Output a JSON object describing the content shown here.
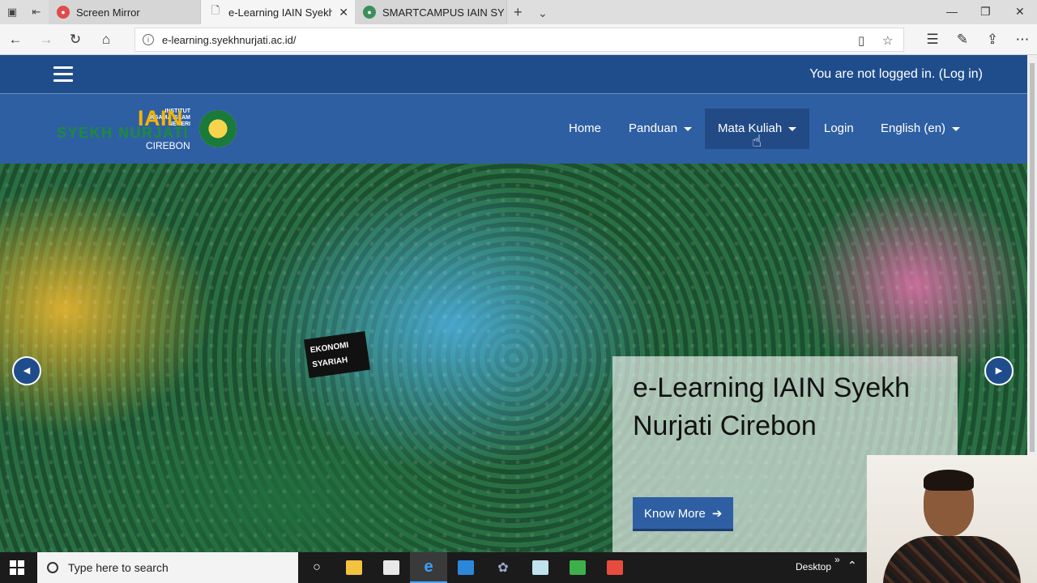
{
  "browser": {
    "tabs": [
      {
        "label": "Screen Mirror",
        "state": "inactive"
      },
      {
        "label": "e-Learning IAIN Syekh N",
        "state": "active"
      },
      {
        "label": "SMARTCAMPUS IAIN SYEKH",
        "state": "inactive"
      }
    ],
    "url": "e-learning.syekhnurjati.ac.id/"
  },
  "site": {
    "login_text": "You are not logged in.",
    "login_link": "(Log in)",
    "logo": {
      "small_line1": "INSTITUT",
      "small_line2": "AGAMA ISLAM",
      "small_line3": "NEGERI",
      "iain": "IAIN",
      "syekh": "SYEKH NURJATI",
      "city": "CIREBON"
    },
    "menu": [
      {
        "label": "Home",
        "has_caret": false
      },
      {
        "label": "Panduan",
        "has_caret": true
      },
      {
        "label": "Mata Kuliah",
        "has_caret": true
      },
      {
        "label": "Login",
        "has_caret": false
      },
      {
        "label": "English (en)",
        "has_caret": true
      }
    ],
    "hero": {
      "title": "e-Learning IAIN Syekh Nurjati Cirebon",
      "button": "Know More",
      "sign_line1": "EKONOMI",
      "sign_line2": "SYARIAH"
    }
  },
  "taskbar": {
    "search_placeholder": "Type here to search",
    "desktop_label": "Desktop"
  },
  "colors": {
    "header_dark": "#1f4d8c",
    "header": "#2f5fa3",
    "accent_yellow": "#f4b400",
    "accent_green": "#1c8c3a"
  }
}
